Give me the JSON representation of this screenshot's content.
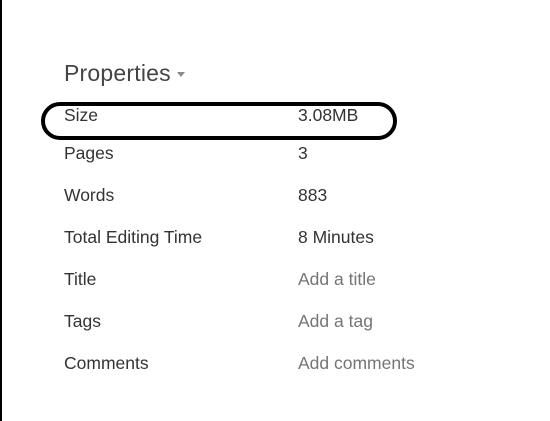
{
  "properties": {
    "header": "Properties",
    "rows": [
      {
        "label": "Size",
        "value": "3.08MB",
        "editable": false
      },
      {
        "label": "Pages",
        "value": "3",
        "editable": false
      },
      {
        "label": "Words",
        "value": "883",
        "editable": false
      },
      {
        "label": "Total Editing Time",
        "value": "8 Minutes",
        "editable": false
      },
      {
        "label": "Title",
        "value": "Add a title",
        "editable": true
      },
      {
        "label": "Tags",
        "value": "Add a tag",
        "editable": true
      },
      {
        "label": "Comments",
        "value": "Add comments",
        "editable": true
      }
    ]
  },
  "colors": {
    "text": "#333333",
    "placeholder": "#757575",
    "header": "#444444",
    "highlight_outline": "#000000"
  },
  "icons": {
    "header_dropdown": "caret-down"
  }
}
